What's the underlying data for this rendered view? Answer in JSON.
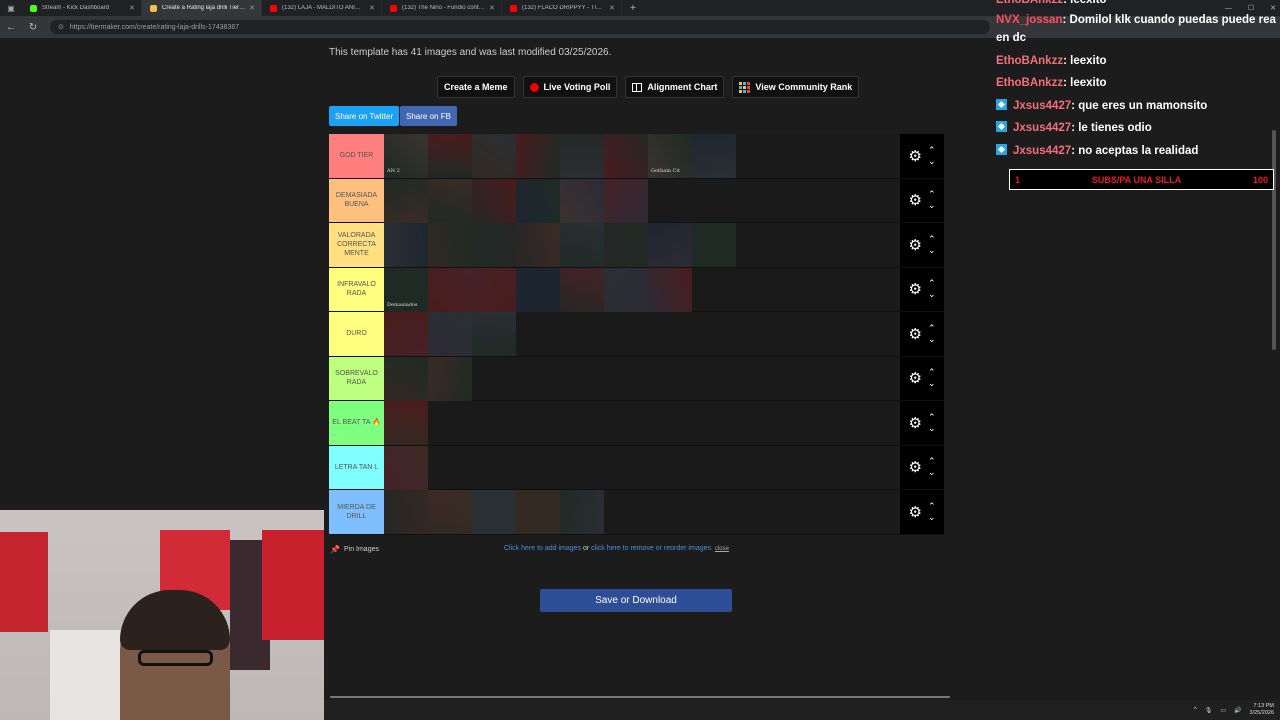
{
  "browser": {
    "tabs": [
      {
        "title": "Stream - Kick Dashboard",
        "favicon_color": "#53fc18",
        "active": false
      },
      {
        "title": "Create a Rating laja drilli Tier List",
        "favicon_color": "#f0c24a",
        "active": true
      },
      {
        "title": "(132) LAJA - MALDITO ANIMAL",
        "favicon_color": "#ff0000",
        "active": false
      },
      {
        "title": "(132) The Nino - Fundio contigo",
        "favicon_color": "#ff0000",
        "active": false
      },
      {
        "title": "(132) FLACO DRIPPYY - TIRALE",
        "favicon_color": "#ff0000",
        "active": false
      }
    ],
    "new_tab": "+",
    "url": "https://tiermaker.com/create/rating-laja-drills-17438367"
  },
  "page": {
    "info_text": "This template has 41 images and was last modified 03/25/2026.",
    "buttons": {
      "create_meme": "Create a Meme",
      "live_voting": "Live Voting Poll",
      "alignment": "Alignment Chart",
      "community": "View Community Rank"
    },
    "share_twitter": "Share on Twitter",
    "share_fb": "Share on FB",
    "tiers": [
      {
        "label": "GOD TIER",
        "color": "#ff7f7f",
        "items": 8
      },
      {
        "label": "DEMASIADA BUENA",
        "color": "#ffbf7f",
        "items": 6
      },
      {
        "label": "VALORADA CORRECTA MENTE",
        "color": "#ffdf7f",
        "items": 8
      },
      {
        "label": "INFRAVALO RADA",
        "color": "#ffff7f",
        "items": 7
      },
      {
        "label": "DURO",
        "color": "#ffff7f",
        "items": 3
      },
      {
        "label": "SOBREVALO RADA",
        "color": "#bfff7f",
        "items": 2
      },
      {
        "label": "EL BEAT TA 🔥",
        "color": "#7fff7f",
        "items": 1
      },
      {
        "label": "LETRA TAN L",
        "color": "#7fffff",
        "items": 1
      },
      {
        "label": "MIERDA DE DRILL",
        "color": "#7fbfff",
        "items": 5
      }
    ],
    "thumb_captions": {
      "godtier_1": "AN 2",
      "godtier_7": "Gotham Cit",
      "infra_1": "Demasiados"
    },
    "pin_images": "Pin Images",
    "help": {
      "add": "Click here to add images",
      "or": " or ",
      "remove": "click here to remove or reorder images.",
      "close": "close"
    },
    "save": "Save or Download"
  },
  "chat": {
    "messages": [
      {
        "user": "EthoBAnkzz",
        "text": ": leexito",
        "badge": false
      },
      {
        "user": "NVX_jossan",
        "text": ": Domilol klk cuando puedas puede rea",
        "badge": false
      },
      {
        "user": "",
        "text": "en dc",
        "badge": false
      },
      {
        "user": "EthoBAnkzz",
        "text": ": leexito",
        "badge": false
      },
      {
        "user": "EthoBAnkzz",
        "text": ": leexito",
        "badge": false
      },
      {
        "user": "Jxsus4427",
        "text": ": que eres un mamonsito",
        "badge": true
      },
      {
        "user": "Jxsus4427",
        "text": ": le tienes odio",
        "badge": true
      },
      {
        "user": "Jxsus4427",
        "text": ": no aceptas la realidad",
        "badge": true
      }
    ],
    "goal": {
      "left": "1",
      "title": "SUBS/PA UNA SILLA",
      "right": "100"
    }
  },
  "taskbar": {
    "time": "7:13 PM",
    "date": "3/25/2026"
  }
}
